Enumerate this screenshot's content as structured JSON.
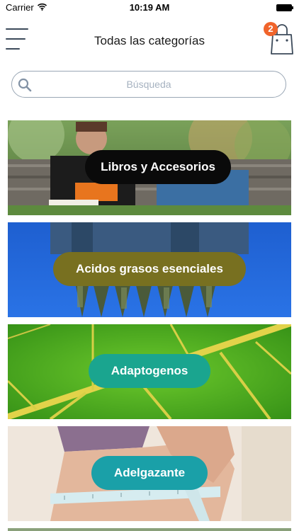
{
  "status_bar": {
    "carrier": "Carrier",
    "time": "10:19 AM"
  },
  "header": {
    "title": "Todas las categorías",
    "cart_count": "2"
  },
  "search": {
    "placeholder": "Búsqueda"
  },
  "categories": [
    {
      "label": "Libros y Accesorios",
      "color": "#0a0a0a"
    },
    {
      "label": "Acidos grasos esenciales",
      "color": "#787020"
    },
    {
      "label": "Adaptogenos",
      "color": "#1aa58f"
    },
    {
      "label": "Adelgazante",
      "color": "#1aa0a8"
    }
  ],
  "icons": [
    "menu-icon",
    "wifi-icon",
    "battery-icon",
    "shopping-bag-icon",
    "search-icon"
  ]
}
